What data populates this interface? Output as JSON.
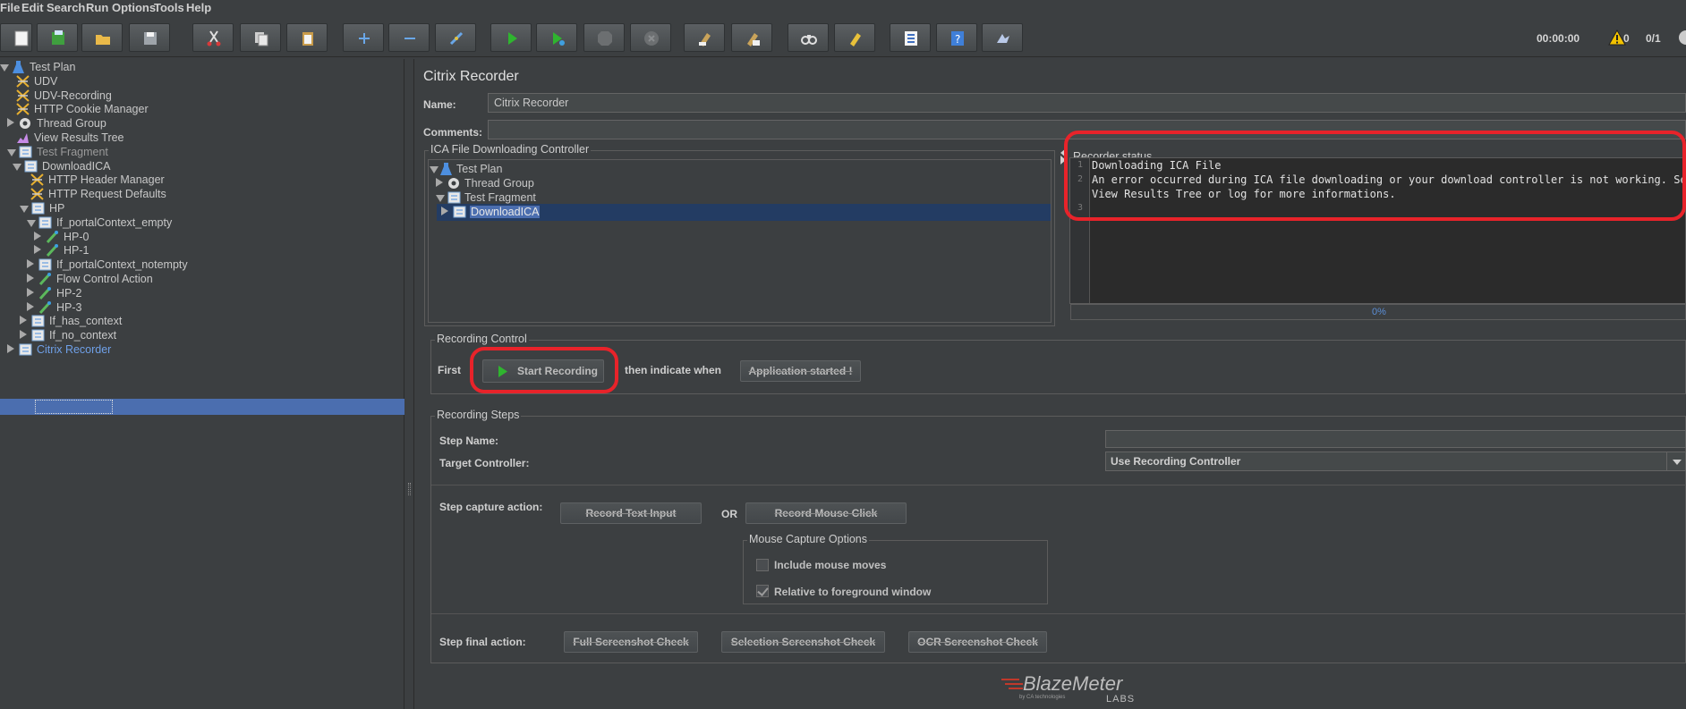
{
  "menu": [
    "File",
    "Edit",
    "Search",
    "Run",
    "Options",
    "Tools",
    "Help"
  ],
  "toolbar": {
    "buttons": [
      "new-icon",
      "templates-icon",
      "open-icon",
      "save-icon",
      "cut-icon",
      "copy-icon",
      "paste-icon",
      "expand-icon",
      "collapse-icon",
      "toggle-icon",
      "start-icon",
      "start-no-pause-icon",
      "stop-icon",
      "shutdown-icon",
      "clear-icon",
      "clear-all-icon",
      "search-icon",
      "reset-search-icon",
      "function-helper-icon",
      "help-icon",
      "remote-icon"
    ],
    "timer": "00:00:00",
    "warnings": "0",
    "threads": "0/1"
  },
  "tree": {
    "items": [
      {
        "label": "Test Plan",
        "icon": "test-plan-icon"
      },
      {
        "label": "UDV",
        "icon": "config-icon"
      },
      {
        "label": "UDV-Recording",
        "icon": "config-icon"
      },
      {
        "label": "HTTP Cookie Manager",
        "icon": "config-icon"
      },
      {
        "label": "Thread Group",
        "icon": "gear-icon"
      },
      {
        "label": "View Results Tree",
        "icon": "listener-icon"
      },
      {
        "label": "Test Fragment",
        "icon": "controller-icon"
      },
      {
        "label": "DownloadICA",
        "icon": "controller-icon"
      },
      {
        "label": "HTTP Header Manager",
        "icon": "config-icon"
      },
      {
        "label": "HTTP Request Defaults",
        "icon": "config-icon"
      },
      {
        "label": "HP",
        "icon": "controller-icon"
      },
      {
        "label": "If_portalContext_empty",
        "icon": "controller-icon"
      },
      {
        "label": "HP-0",
        "icon": "sampler-icon"
      },
      {
        "label": "HP-1",
        "icon": "sampler-icon"
      },
      {
        "label": "If_portalContext_notempty",
        "icon": "controller-icon"
      },
      {
        "label": "Flow Control Action",
        "icon": "sampler-icon"
      },
      {
        "label": "HP-2",
        "icon": "sampler-icon"
      },
      {
        "label": "HP-3",
        "icon": "sampler-icon"
      },
      {
        "label": "If_has_context",
        "icon": "controller-icon"
      },
      {
        "label": "If_no_context",
        "icon": "controller-icon"
      },
      {
        "label": "Citrix Recorder",
        "icon": "controller-icon"
      }
    ]
  },
  "main": {
    "title": "Citrix Recorder",
    "name_label": "Name:",
    "name_value": "Citrix Recorder",
    "comments_label": "Comments:",
    "comments_value": "",
    "ica_legend": "ICA File Downloading Controller",
    "ica_tree": [
      "Test Plan",
      "Thread Group",
      "Test Fragment",
      "DownloadICA"
    ],
    "status_legend": "Recorder status",
    "status_lines": [
      "Downloading ICA File",
      "An error occurred during ICA file downloading or your download controller is not working. See",
      "View Results Tree or log for more informations.",
      ""
    ],
    "progress": "0%",
    "progress_fraction": 0,
    "recording_control_legend": "Recording Control",
    "first_label": "First",
    "start_recording": "Start Recording",
    "then_label": "then indicate when",
    "app_started": "Application started !",
    "steps_legend": "Recording Steps",
    "step_name_label": "Step Name:",
    "step_name_value": "",
    "target_label": "Target Controller:",
    "target_value": "Use Recording Controller",
    "capture_label": "Step capture action:",
    "record_text": "Record Text Input",
    "or_label": "OR",
    "record_mouse": "Record Mouse Click",
    "mouse_options_legend": "Mouse Capture Options",
    "include_moves": "Include mouse moves",
    "include_moves_checked": false,
    "relative_fg": "Relative to foreground window",
    "relative_fg_checked": true,
    "final_label": "Step final action:",
    "full_check": "Full Screenshot Check",
    "selection_check": "Selection Screenshot Check",
    "ocr_check": "OCR Screenshot Check"
  },
  "logo": {
    "brand": "BlazeMeter",
    "sub": "LABS",
    "tag": "by CA technologies"
  },
  "colors": {
    "selection": "#4b6eaf",
    "highlight": "#e8232a",
    "background": "#3c3f41"
  }
}
